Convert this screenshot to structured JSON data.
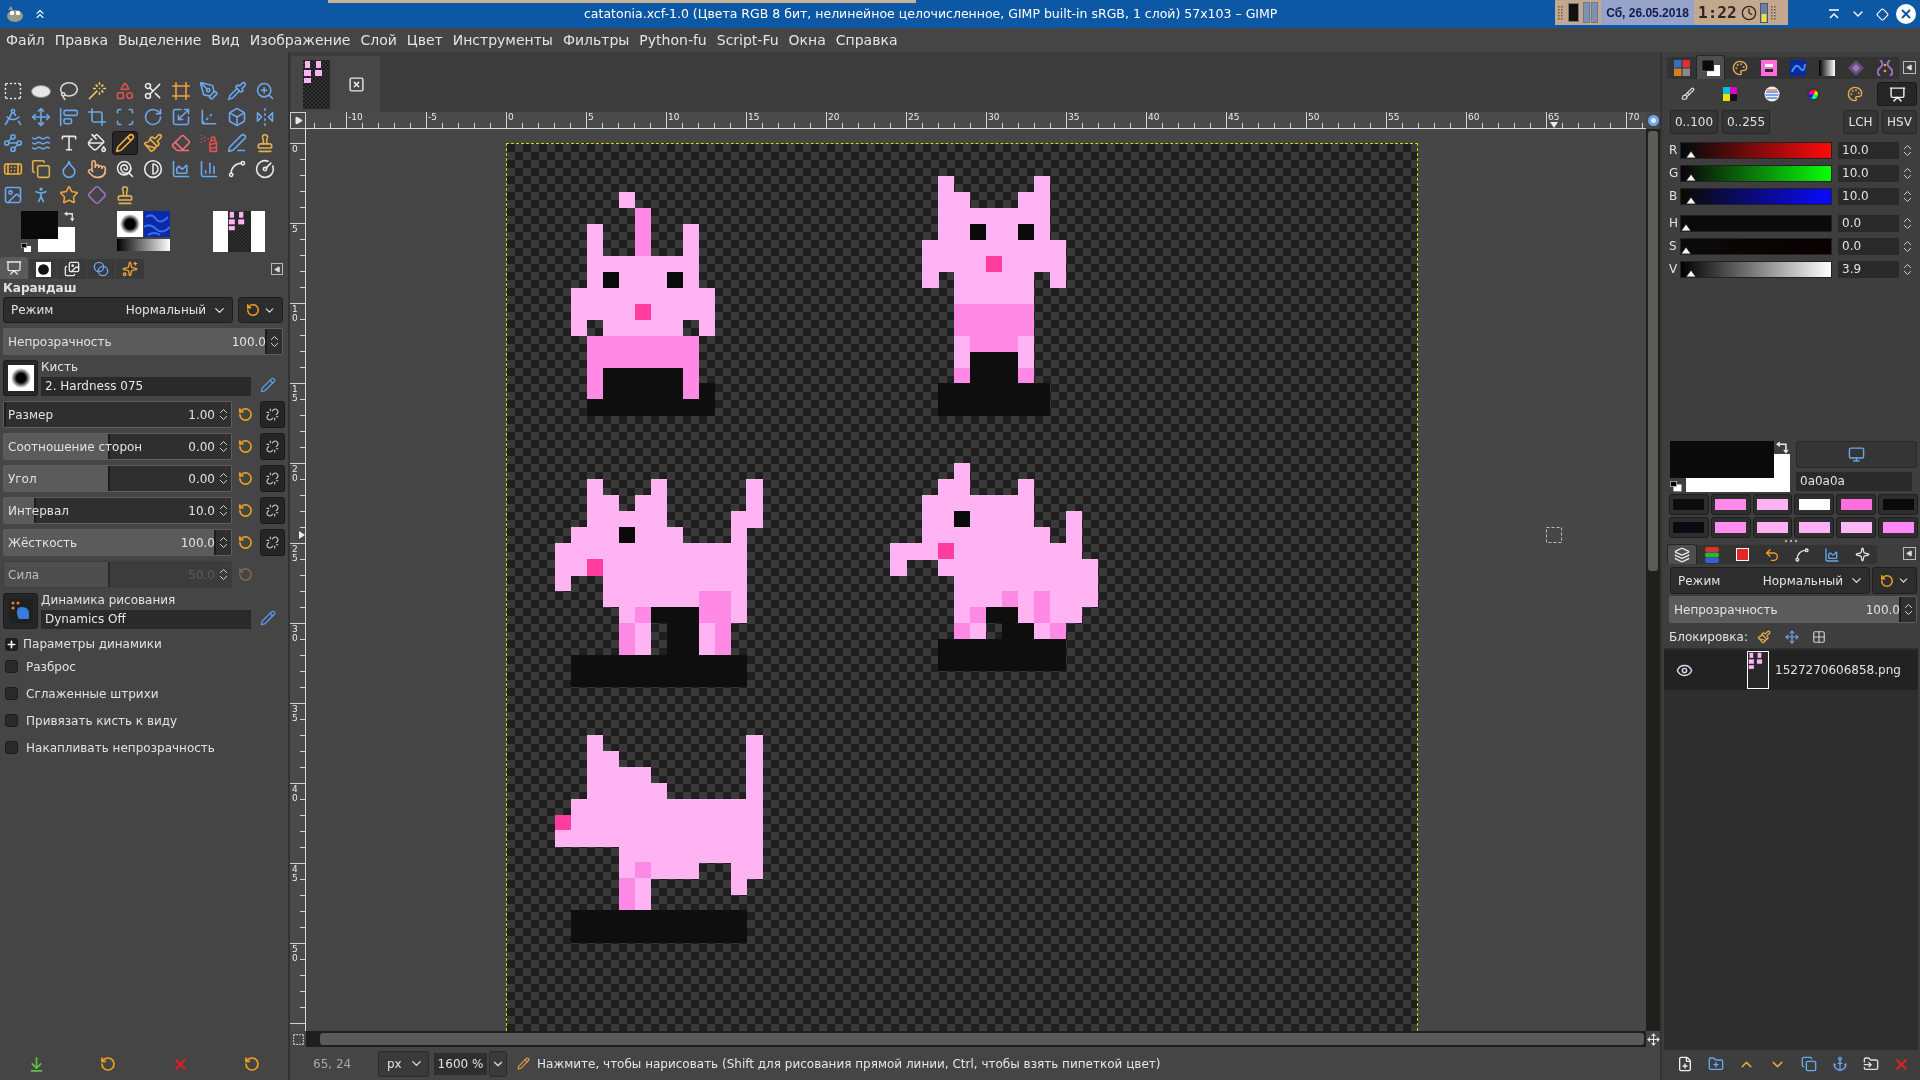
{
  "window": {
    "title": "catatonia.xcf-1.0 (Цвета RGB 8 бит, нелинейное целочисленное, GIMP built-in sRGB, 1 слой) 57x103 – GIMP"
  },
  "tray": {
    "date": "Сб, 26.05.2018",
    "clock": "1:22"
  },
  "menu": [
    "Файл",
    "Правка",
    "Выделение",
    "Вид",
    "Изображение",
    "Слой",
    "Цвет",
    "Инструменты",
    "Фильтры",
    "Python-fu",
    "Script-Fu",
    "Окна",
    "Справка"
  ],
  "toolbox": {
    "tools": [
      {
        "selected": false
      },
      {
        "selected": false
      },
      {
        "selected": false
      },
      {
        "selected": false
      },
      {
        "selected": false
      },
      {
        "selected": false
      },
      {
        "selected": false
      },
      {
        "selected": false
      },
      {
        "selected": false
      },
      {
        "selected": false
      },
      {
        "selected": false
      },
      {
        "selected": false
      },
      {
        "selected": false
      },
      {
        "selected": false
      },
      {
        "selected": false
      },
      {
        "selected": false
      },
      {
        "selected": false
      },
      {
        "selected": false
      },
      {
        "selected": false
      },
      {
        "selected": false
      },
      {
        "selected": false
      },
      {
        "selected": false
      },
      {
        "selected": false
      },
      {
        "selected": false
      },
      {
        "selected": true
      },
      {
        "selected": false
      },
      {
        "selected": false
      },
      {
        "selected": false
      },
      {
        "selected": false
      },
      {
        "selected": false
      },
      {
        "selected": false
      },
      {
        "selected": false
      },
      {
        "selected": false
      },
      {
        "selected": false
      },
      {
        "selected": false
      },
      {
        "selected": false
      },
      {
        "selected": false
      },
      {
        "selected": false
      },
      {
        "selected": false
      },
      {
        "selected": false
      },
      {
        "selected": false
      },
      {
        "selected": false
      },
      {
        "selected": false
      },
      {
        "selected": false
      },
      {
        "selected": false
      }
    ]
  },
  "color_area": {
    "swatches": [
      {
        "kind": "foreground",
        "color": "#0a0a0a"
      },
      {
        "kind": "background",
        "color": "#ffffff"
      }
    ]
  },
  "left_dock": {
    "tabs": [
      {
        "selected": true
      },
      {
        "selected": false
      },
      {
        "selected": false
      },
      {
        "selected": false
      },
      {
        "selected": false
      }
    ]
  },
  "tool_options": {
    "title": "Карандаш",
    "mode": {
      "label": "Режим",
      "value": "Нормальный"
    },
    "opacity": {
      "label": "Непрозрачность",
      "value": "100.0",
      "level": 1
    },
    "brush": {
      "label": "Кисть",
      "value": "2. Hardness 075"
    },
    "sliders": [
      {
        "label": "Размер",
        "value": "1.00",
        "level": 0,
        "disabled": false,
        "link_button": true
      },
      {
        "label": "Соотношение сторон",
        "value": "0.00",
        "level": 0.5,
        "disabled": false,
        "link_button": true
      },
      {
        "label": "Угол",
        "value": "0.00",
        "level": 0.5,
        "disabled": false,
        "link_button": true
      },
      {
        "label": "Интервал",
        "value": "10.0",
        "level": 0.15,
        "disabled": false,
        "link_button": true
      },
      {
        "label": "Жёсткость",
        "value": "100.0",
        "level": 1,
        "disabled": false,
        "link_button": true
      },
      {
        "label": "Сила",
        "value": "50.0",
        "level": 0.5,
        "disabled": true,
        "link_button": false
      }
    ],
    "dynamics": {
      "label": "Динамика рисования",
      "value": "Dynamics Off"
    },
    "dynamics_options": {
      "label": "Параметры динамики",
      "expanded": false
    },
    "checkboxes": [
      {
        "label": "Разброс",
        "checked": false
      },
      {
        "label": "Сглаженные штрихи",
        "checked": false
      },
      {
        "label": "Привязать кисть к виду",
        "checked": false
      },
      {
        "label": "Накапливать непрозрачность",
        "checked": false
      }
    ]
  },
  "image_tabs": [
    {
      "selected": true
    }
  ],
  "rulers": {
    "horizontal": [
      "-10",
      "-5",
      "0",
      "5",
      "10",
      "15",
      "20",
      "25",
      "30",
      "35",
      "40",
      "45",
      "50",
      "55",
      "60",
      "65",
      "70"
    ],
    "vertical": [
      "0",
      "5",
      "10",
      "15",
      "20",
      "25",
      "30",
      "35",
      "40",
      "45",
      "50"
    ]
  },
  "status_bar": {
    "coordinates": "65, 24",
    "unit": "px",
    "zoom": "1600 %",
    "message": "Нажмите, чтобы нарисовать (Shift для рисования прямой линии, Ctrl, чтобы взять пипеткой цвет)"
  },
  "right_dock": {
    "tabs": [
      {
        "selected": false
      },
      {
        "selected": true
      },
      {
        "selected": false
      },
      {
        "selected": false
      },
      {
        "selected": false
      },
      {
        "selected": false
      },
      {
        "selected": false
      },
      {
        "selected": false
      }
    ],
    "selector_modes": [
      {
        "selected": false
      },
      {
        "selected": false
      },
      {
        "selected": false
      },
      {
        "selected": false
      },
      {
        "selected": false
      },
      {
        "selected": true
      }
    ],
    "range_buttons": [
      "0..100",
      "0..255"
    ],
    "model_buttons": [
      "LCH",
      "HSV"
    ],
    "channels": [
      {
        "kind": "r",
        "label": "R",
        "value": "10.0",
        "level": 0.039
      },
      {
        "kind": "g",
        "label": "G",
        "value": "10.0",
        "level": 0.039
      },
      {
        "kind": "b",
        "label": "B",
        "value": "10.0",
        "level": 0.039
      },
      {
        "kind": "h",
        "label": "H",
        "value": "0.0",
        "level": 0
      },
      {
        "kind": "s",
        "label": "S",
        "value": "0.0",
        "level": 0
      },
      {
        "kind": "v",
        "label": "V",
        "value": "3.9",
        "level": 0.039
      }
    ],
    "swatches": [
      {
        "kind": "foreground",
        "color": "#0a0a0a"
      },
      {
        "kind": "background",
        "color": "#ffffff"
      }
    ],
    "hex": "0a0a0a",
    "history": [
      {
        "color": "#0d0d0d"
      },
      {
        "color": "#ff88e8"
      },
      {
        "color": "#ffb3f3"
      },
      {
        "color": "#ffffff"
      },
      {
        "color": "#ff6fe0"
      },
      {
        "color": "#0a0a0a"
      },
      {
        "color": "#0a0a12"
      },
      {
        "color": "#ff8ef0"
      },
      {
        "color": "#ffb0f0"
      },
      {
        "color": "#ffb0f4"
      },
      {
        "color": "#ffb8f6"
      },
      {
        "color": "#ff88f8"
      }
    ],
    "layers": {
      "tabs": [
        {
          "selected": true
        },
        {
          "selected": false
        },
        {
          "selected": false
        },
        {
          "selected": false
        },
        {
          "selected": false
        },
        {
          "selected": false
        },
        {
          "selected": false
        }
      ],
      "mode": {
        "label": "Режим",
        "value": "Нормальный"
      },
      "opacity": {
        "label": "Непрозрачность",
        "value": "100.0",
        "level": 1
      },
      "lock_label": "Блокировка:",
      "items": [
        {
          "name": "1527270606858.png",
          "visible": true,
          "selected": true
        }
      ]
    }
  }
}
